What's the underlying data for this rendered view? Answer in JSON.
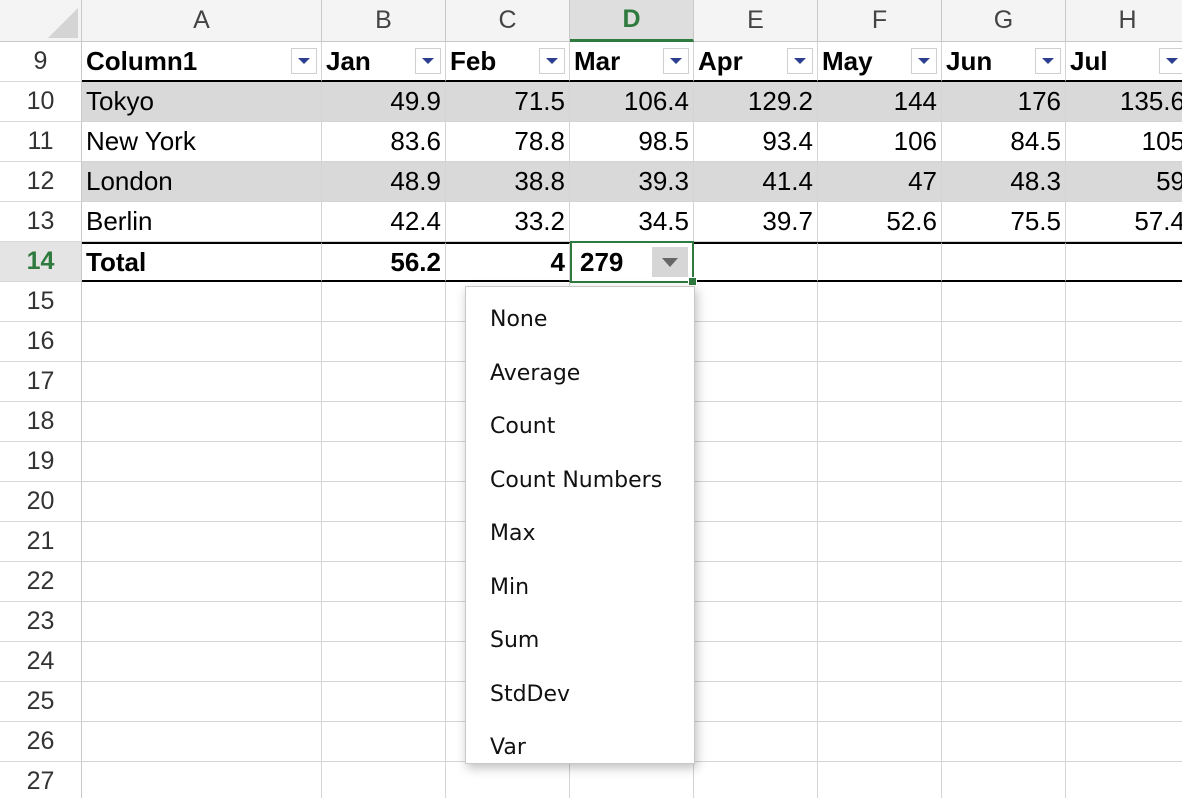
{
  "columns": [
    "A",
    "B",
    "C",
    "D",
    "E",
    "F",
    "G",
    "H"
  ],
  "active_column": "D",
  "row_numbers": [
    "9",
    "10",
    "11",
    "12",
    "13",
    "14",
    "15",
    "16",
    "17",
    "18",
    "19",
    "20",
    "21",
    "22",
    "23",
    "24",
    "25",
    "26",
    "27"
  ],
  "active_row": "14",
  "table": {
    "headers": [
      "Column1",
      "Jan",
      "Feb",
      "Mar",
      "Apr",
      "May",
      "Jun",
      "Jul"
    ],
    "rows": [
      [
        "Tokyo",
        "49.9",
        "71.5",
        "106.4",
        "129.2",
        "144",
        "176",
        "135.6"
      ],
      [
        "New York",
        "83.6",
        "78.8",
        "98.5",
        "93.4",
        "106",
        "84.5",
        "105"
      ],
      [
        "London",
        "48.9",
        "38.8",
        "39.3",
        "41.4",
        "47",
        "48.3",
        "59"
      ],
      [
        "Berlin",
        "42.4",
        "33.2",
        "34.5",
        "39.7",
        "52.6",
        "75.5",
        "57.4"
      ]
    ],
    "total_row": [
      "Total",
      "56.2",
      "4",
      "279",
      "",
      "",
      "",
      ""
    ]
  },
  "total_function_menu": {
    "items": [
      "None",
      "Average",
      "Count",
      "Count Numbers",
      "Max",
      "Min",
      "Sum",
      "StdDev",
      "Var"
    ]
  },
  "colors": {
    "accent_green": "#2f7a3e",
    "band_gray": "#d9d9d9",
    "filter_arrow": "#2c3e8f"
  },
  "icons": {
    "filter": "chevron-down-icon",
    "total_dropdown": "dropdown-arrow-icon"
  }
}
